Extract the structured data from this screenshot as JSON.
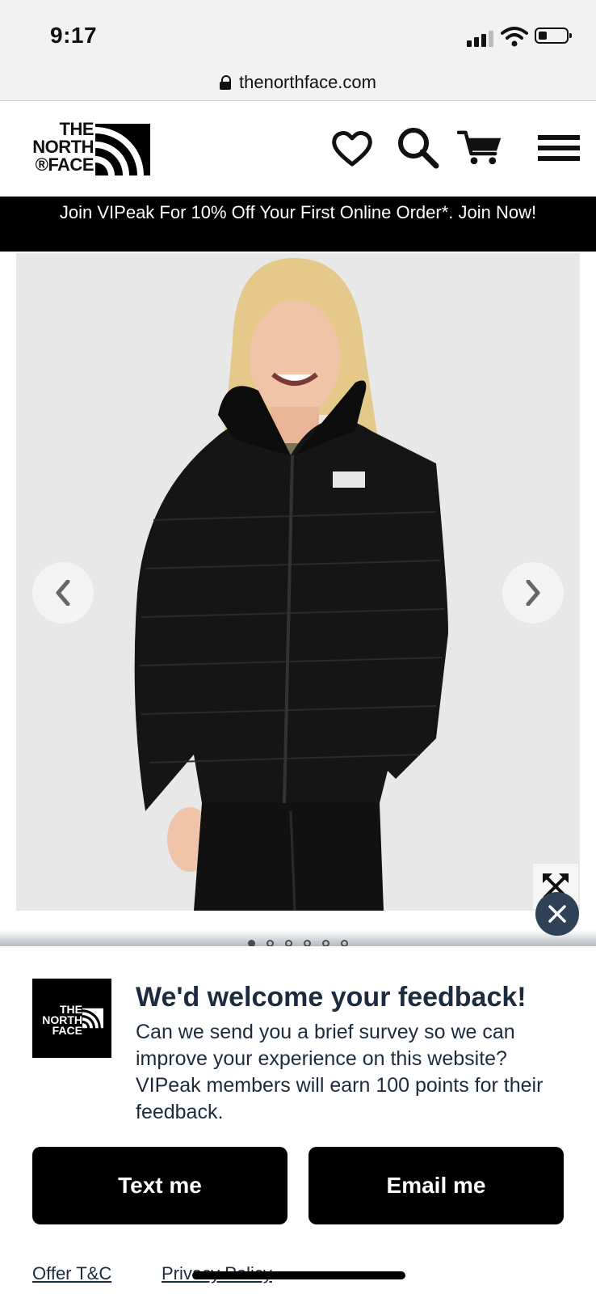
{
  "status_bar": {
    "time": "9:17"
  },
  "browser": {
    "url": "thenorthface.com"
  },
  "header": {
    "logo_lines": [
      "THE",
      "NORTH",
      "®FACE"
    ],
    "icons": [
      "heart-icon",
      "search-icon",
      "cart-icon",
      "menu-icon"
    ]
  },
  "promo": {
    "text": "Join VIPeak For 10% Off Your First Online Order*. Join Now!"
  },
  "carousel": {
    "slides": 6,
    "active_index": 0
  },
  "survey": {
    "title": "We'd welcome your feedback!",
    "body": "Can we send you a brief survey so we can improve your experience on this website? VIPeak members will earn 100 points for their feedback.",
    "text_button": "Text me",
    "email_button": "Email me",
    "offer_link": "Offer T&C",
    "privacy_link": "Privacy Policy",
    "logo_lines": [
      "THE",
      "NORTH",
      "FACE"
    ]
  },
  "colors": {
    "brand_black": "#000000",
    "survey_text": "#1d2b3e",
    "close_chip": "#2e4157",
    "image_bg": "#e8e8e9"
  }
}
